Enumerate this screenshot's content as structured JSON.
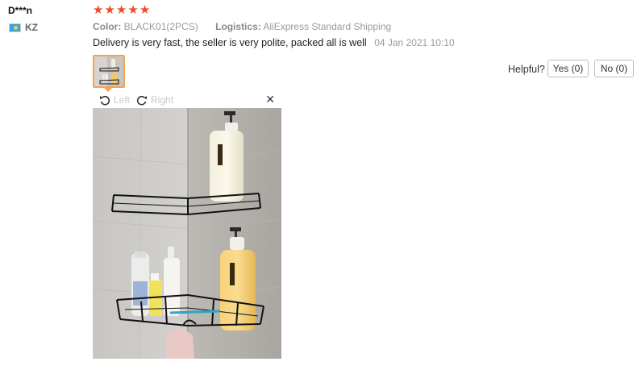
{
  "reviewer": {
    "name": "D***n",
    "country": "KZ",
    "flag_icon": "kz-flag-icon"
  },
  "rating": {
    "stars": 5,
    "max": 5,
    "color": "#f04a28"
  },
  "attributes": {
    "color_label": "Color:",
    "color_value": "BLACK01(2PCS)",
    "logistics_label": "Logistics:",
    "logistics_value": "AliExpress Standard Shipping"
  },
  "review": {
    "text": "Delivery is very fast, the seller is very polite, packed all is well",
    "date": "04 Jan 2021 10:10"
  },
  "viewer": {
    "left_label": "Left",
    "right_label": "Right",
    "close_icon": "close-icon",
    "thumb_border_color": "#f5a253"
  },
  "feedback": {
    "helpful_label": "Helpful?",
    "yes_label": "Yes (0)",
    "no_label": "No (0)"
  }
}
